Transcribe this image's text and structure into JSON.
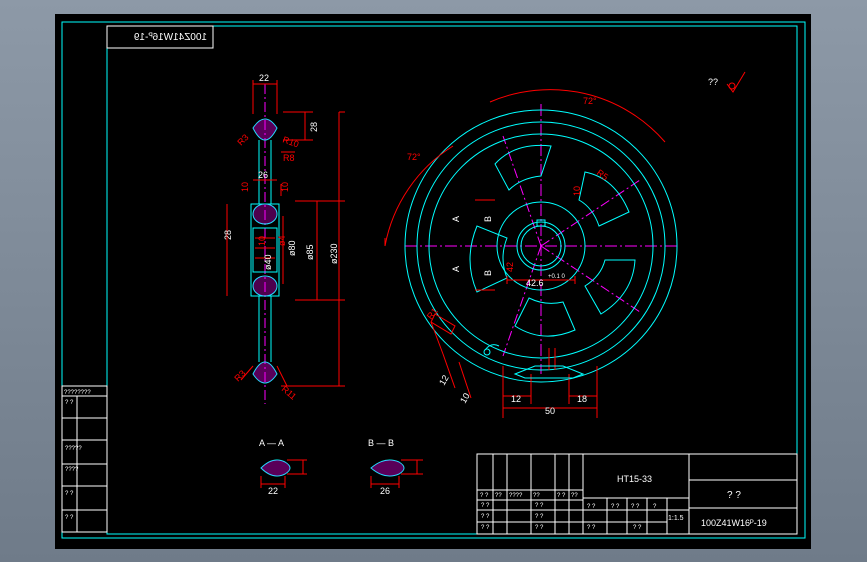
{
  "colors": {
    "background": "#000000",
    "frame": "#00ffff",
    "outline": "#00ffff",
    "dimension": "#ff0000",
    "centerline": "#ff00ff",
    "text": "#ffffff",
    "viewport": "#7f8b99"
  },
  "title_strip": {
    "text": "100Z41W16ᴾ-19"
  },
  "roughness_note": {
    "value": "??",
    "icon": "roughness-symbol-icon"
  },
  "side_view": {
    "dims": {
      "rim_width": "22",
      "rim_height": "28",
      "hub_width": "26",
      "hub_height": "28",
      "overall_diameter": "ø230",
      "hub_od": "ø85",
      "bore_d1": "ø80",
      "bore_d2": "ø40",
      "keyway": "ø4",
      "r3_top": "R3",
      "r10": "R10",
      "r8": "R8",
      "r3_bottom": "R3",
      "r11": "R11",
      "small_a": "10",
      "small_b": "10",
      "hub_note": "10"
    }
  },
  "front_view": {
    "dims": {
      "angle_top": "72°",
      "angle_left": "72°",
      "radius_r5": "R5",
      "bore_width": "42.6",
      "bore_tol": "+0.1 0",
      "keyway_dim": "12",
      "keyway_depth": "10",
      "tooth_width": "50",
      "tooth_left": "12",
      "tooth_right": "18",
      "key_label": "10",
      "hub_inner": "42",
      "small_r": "R1"
    },
    "section_labels": {
      "a_top": "A",
      "b_top": "B",
      "a_bottom": "A",
      "b_bottom": "B"
    }
  },
  "sections": {
    "a_title": "A — A",
    "a_width": "22",
    "b_title": "B — B",
    "b_width": "26"
  },
  "left_strip": {
    "rows": [
      "????????",
      "?    ?",
      "?????",
      "????",
      "?    ?",
      "?    ?"
    ]
  },
  "title_block": {
    "material": "HT15-33",
    "company": "?    ?",
    "drawing_no": "100Z41W16ᴾ-19",
    "scale": "1:1.5",
    "header_cells": [
      "? ?",
      "??",
      "????",
      "??",
      "? ?",
      "??"
    ],
    "rows": [
      [
        "? ?",
        "? ?"
      ],
      [
        "? ?",
        "? ?"
      ],
      [
        "? ?",
        "? ?"
      ],
      [
        "? ?",
        "? ?"
      ]
    ],
    "sheet_labels": [
      "? ?",
      "? ?",
      "? ?",
      "?"
    ]
  }
}
